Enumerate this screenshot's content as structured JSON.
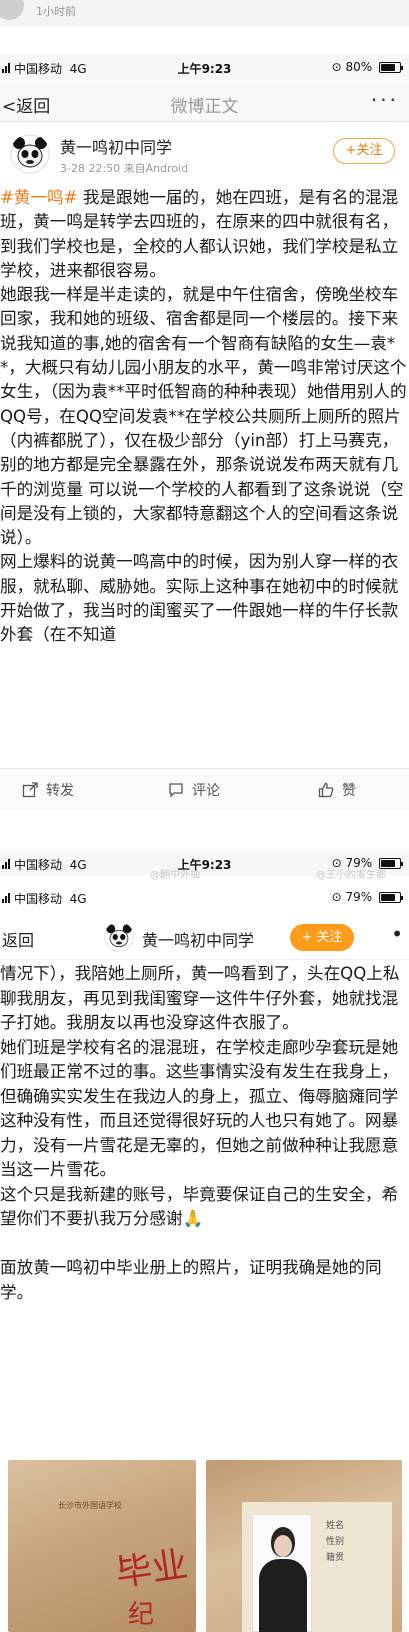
{
  "previous_item": {
    "time": "1小时前"
  },
  "status_bar_1": {
    "carrier": "中国移动",
    "network": "4G",
    "clock": "上午9:23",
    "battery": "80%",
    "battery_level": 0.8
  },
  "nav_1": {
    "back_label": "返回",
    "title": "微博正文",
    "more": "···"
  },
  "author": {
    "name": "黄一鸣初中同学",
    "meta": "3-28 22:50  来自Android",
    "follow_label": "+关注"
  },
  "post": {
    "hashtag": "#黄一鸣#",
    "body": " 我是跟她一届的，她在四班，是有名的混混班，黄一鸣是转学去四班的，在原来的四中就很有名，到我们学校也是，全校的人都认识她，我们学校是私立学校，进来都很容易。\n她跟我一样是半走读的，就是中午住宿舍，傍晚坐校车回家，我和她的班级、宿舍都是同一个楼层的。接下来说我知道的事,她的宿舍有一个智商有缺陷的女生—袁**，大概只有幼儿园小朋友的水平，黄一鸣非常讨厌这个女生，（因为袁**平时低智商的种种表现）她借用别人的QQ号，在QQ空间发袁**在学校公共厕所上厕所的照片（内裤都脱了），仅在极少部分（yin部）打上马赛克，别的地方都是完全暴露在外，那条说说发布两天就有几千的浏览量 可以说一个学校的人都看到了这条说说（空间是没有上锁的，大家都特意翻这个人的空间看这条说说）。\n    网上爆料的说黄一鸣高中的时候，因为别人穿一样的衣服，就私聊、威胁她。实际上这种事在她初中的时候就开始做了，我当时的闺蜜买了一件跟她一样的牛仔长款外套（在不知道"
  },
  "actions": {
    "repost": "转发",
    "comment": "评论",
    "like": "赞"
  },
  "status_bar_2": {
    "carrier": "中国移动",
    "network": "4G",
    "clock": "上午9:23",
    "battery": "79%",
    "battery_level": 0.79
  },
  "watermarks": [
    "@翻中外抽",
    "@王小的发生都"
  ],
  "nav_2": {
    "back_label": "返回",
    "name": "黄一鸣初中同学",
    "follow_label": "+ 关注",
    "more": "•"
  },
  "post_continued": {
    "body": "情况下），我陪她上厕所，黄一鸣看到了，头在QQ上私聊我朋友，再见到我闺蜜穿一这件牛仔外套，她就找混子打她。我朋友以再也没穿这件衣服了。\n她们班是学校有名的混混班，在学校走廊吵孕套玩是她们班最正常不过的事。这些事情实没有发生在我身上，但确确实实发生在我边人的身上，孤立、侮辱脑瘫同学这种没有性，而且还觉得很好玩的人也只有她了。网暴力，没有一片雪花是无辜的，但她之前做种种让我愿意当这一片雪花。\n这个只是我新建的账号，毕竟要保证自己的生安全，希望你们不要扒我万分感谢🙏\n\n面放黄一鸣初中毕业册上的照片，证明我确是她的同学。"
  },
  "photos": {
    "photo1": {
      "school_text": "长沙市外国语学校",
      "big_text": "毕业",
      "big_text_2": "纪"
    },
    "photo2": {
      "notes": "姓名\n性别\n籍贯"
    }
  }
}
